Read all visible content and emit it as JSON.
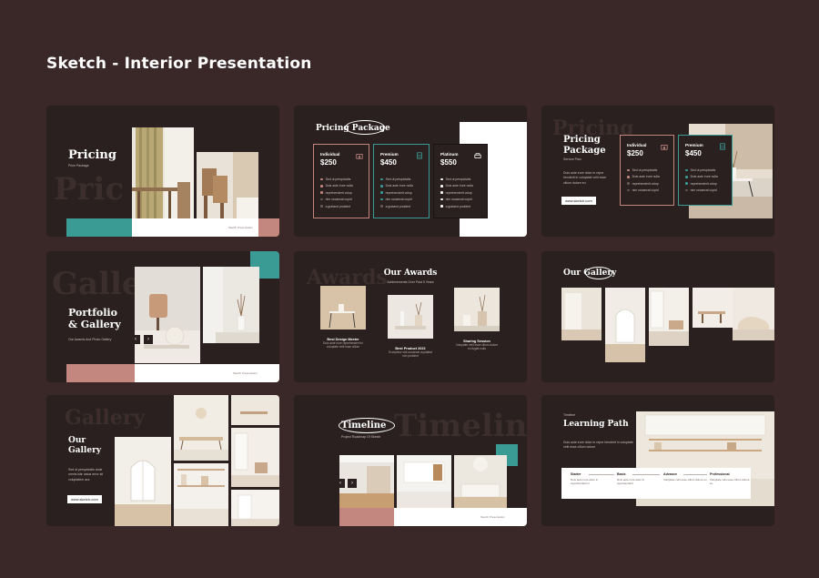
{
  "page": {
    "heading": "Sketch - Interior Presentation",
    "colors": {
      "background": "#3a2727",
      "slide": "#2a2020",
      "teal": "#3a9a94",
      "rose": "#c3877f",
      "white": "#ffffff"
    }
  },
  "slides": [
    {
      "id": "pricing-cover",
      "title": "Pricing",
      "subtitle": "Price Package",
      "ghost": "Pric",
      "footer": "Sketch Presentation"
    },
    {
      "id": "pricing-package",
      "title": "Pricing Package",
      "cards": [
        {
          "name": "Individual",
          "price": "$250",
          "icon": "house-icon",
          "accent": "#c3877f",
          "items": [
            "Sed ut perspiciatis",
            "Duis aute irure nulla",
            "reprehenderit volup",
            "nim occaecat cupid",
            "a gratand proident"
          ]
        },
        {
          "name": "Premium",
          "price": "$450",
          "icon": "building-icon",
          "accent": "#3a9a94",
          "items": [
            "Sed ut perspiciatis",
            "Duis aute irure nulla",
            "reprehenderit volup",
            "nim occaecat cupid",
            "a gratand proident"
          ]
        },
        {
          "name": "Platinum",
          "price": "$550",
          "icon": "sofa-icon",
          "accent": "#ffffff",
          "items": [
            "Sed ut perspiciatis",
            "Duis aute irure nulla",
            "reprehenderit volup",
            "nim occaecat cupid",
            "a gratand proident"
          ]
        }
      ]
    },
    {
      "id": "pricing-package-2",
      "title_line1": "Pricing",
      "title_line2": "Package",
      "ghost": "Pricing",
      "subtitle": "Service Plan",
      "body": "Duis aute irure dolor in repre henderit in voluptate velit esse cillum dolore eu",
      "button": "www.sketch.com",
      "cards": [
        {
          "name": "Individual",
          "price": "$250",
          "icon": "house-icon",
          "accent": "#c3877f",
          "items": [
            "Sed ut perspiciatis",
            "Duis aute irure nulla",
            "reprehenderit volup",
            "nim occaecat cupid"
          ]
        },
        {
          "name": "Premium",
          "price": "$450",
          "icon": "building-icon",
          "accent": "#3a9a94",
          "items": [
            "Sed ut perspiciatis",
            "Duis aute irure nulla",
            "reprehenderit volup",
            "nim occaecat cupid"
          ]
        }
      ]
    },
    {
      "id": "portfolio-gallery",
      "title_line1": "Portfolio",
      "title_line2": "& Gallery",
      "ghost": "Galle",
      "subtitle": "Our Awards And Photo Gallery",
      "footer": "Sketch Presentation",
      "prev": "‹",
      "next": "›"
    },
    {
      "id": "our-awards",
      "title": "Our Awards",
      "ghost": "Awards",
      "subtitle": "Achievements Over Past 5 Years",
      "awards": [
        {
          "title": "Best Design Meeter",
          "body": "Duis aute irure reprehenderit in voluptate velit esse cillum"
        },
        {
          "title": "Best Product 2022",
          "body": "Excepteur sint occaecat cupidatat non proident"
        },
        {
          "title": "Sharing Session",
          "body": "Voluptate velit esse cillum dolore eu fugiat nulla"
        }
      ]
    },
    {
      "id": "our-gallery",
      "title": "Our Gallery"
    },
    {
      "id": "gallery-2",
      "title_line1": "Our",
      "title_line2": "Gallery",
      "ghost": "Gallery",
      "body": "Sed ut perspiciatis unde omnis iste natus error sit voluptatem acc",
      "button": "www.sketch.com"
    },
    {
      "id": "timeline",
      "title": "Timeline",
      "ghost": "Timeline",
      "subtitle": "Project Roadmap Of Sketch",
      "footer": "Sketch Presentation",
      "prev": "‹",
      "next": "›"
    },
    {
      "id": "learning-path",
      "kicker": "Timeline",
      "title": "Learning Path",
      "body": "Duis aute irure dolor in repre henderit in voluptate velit esse cillum dolore",
      "steps": [
        {
          "name": "Starter",
          "body": "Duis aute irure dolor in reprehenderit in"
        },
        {
          "name": "Basic",
          "body": "Duis aute irure dolor in reprehenderit"
        },
        {
          "name": "Advance",
          "body": "Voluptate velit esse cillum dolore eu"
        },
        {
          "name": "Professional",
          "body": "Voluptate velit esse cillum dolore eu"
        }
      ]
    }
  ]
}
